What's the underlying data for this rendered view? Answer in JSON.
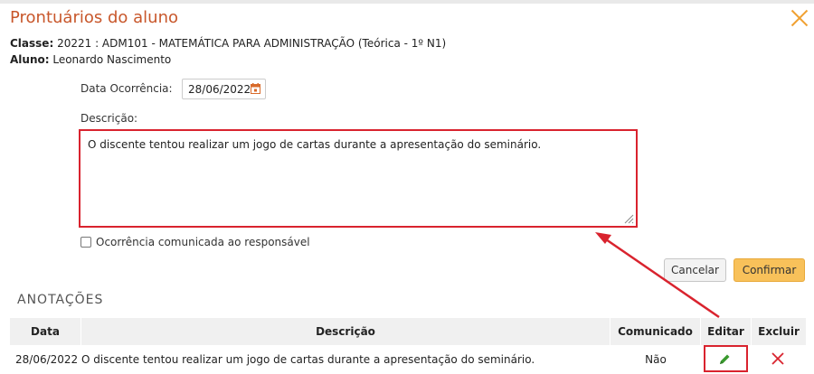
{
  "dialog": {
    "title": "Prontuários do aluno",
    "classe_label": "Classe:",
    "classe_value": "20221 : ADM101 - MATEMÁTICA PARA ADMINISTRAÇÃO (Teórica - 1º N1)",
    "aluno_label": "Aluno:",
    "aluno_value": "Leonardo Nascimento"
  },
  "form": {
    "date_label": "Data Ocorrência:",
    "date_value": "28/06/2022",
    "desc_label": "Descrição:",
    "desc_value": "O discente tentou realizar um jogo de cartas durante a apresentação do seminário.",
    "checkbox_label": "Ocorrência comunicada ao responsável",
    "checkbox_checked": false,
    "cancel_label": "Cancelar",
    "confirm_label": "Confirmar"
  },
  "notes": {
    "section_title": "ANOTAÇÕES",
    "headers": [
      "Data",
      "Descrição",
      "Comunicado",
      "Editar",
      "Excluir"
    ],
    "rows": [
      {
        "data": "28/06/2022",
        "descricao": "O discente tentou realizar um jogo de cartas durante a apresentação do seminário.",
        "comunicado": "Não",
        "edit_icon": "pencil-icon",
        "delete_icon": "close-icon"
      }
    ]
  },
  "colors": {
    "title": "#c8572b",
    "highlight": "#d9232e",
    "confirm_button": "#f8c15a",
    "edit_icon": "#3a9a2e",
    "delete_icon": "#d9232e",
    "close_icon": "#f0a030"
  }
}
